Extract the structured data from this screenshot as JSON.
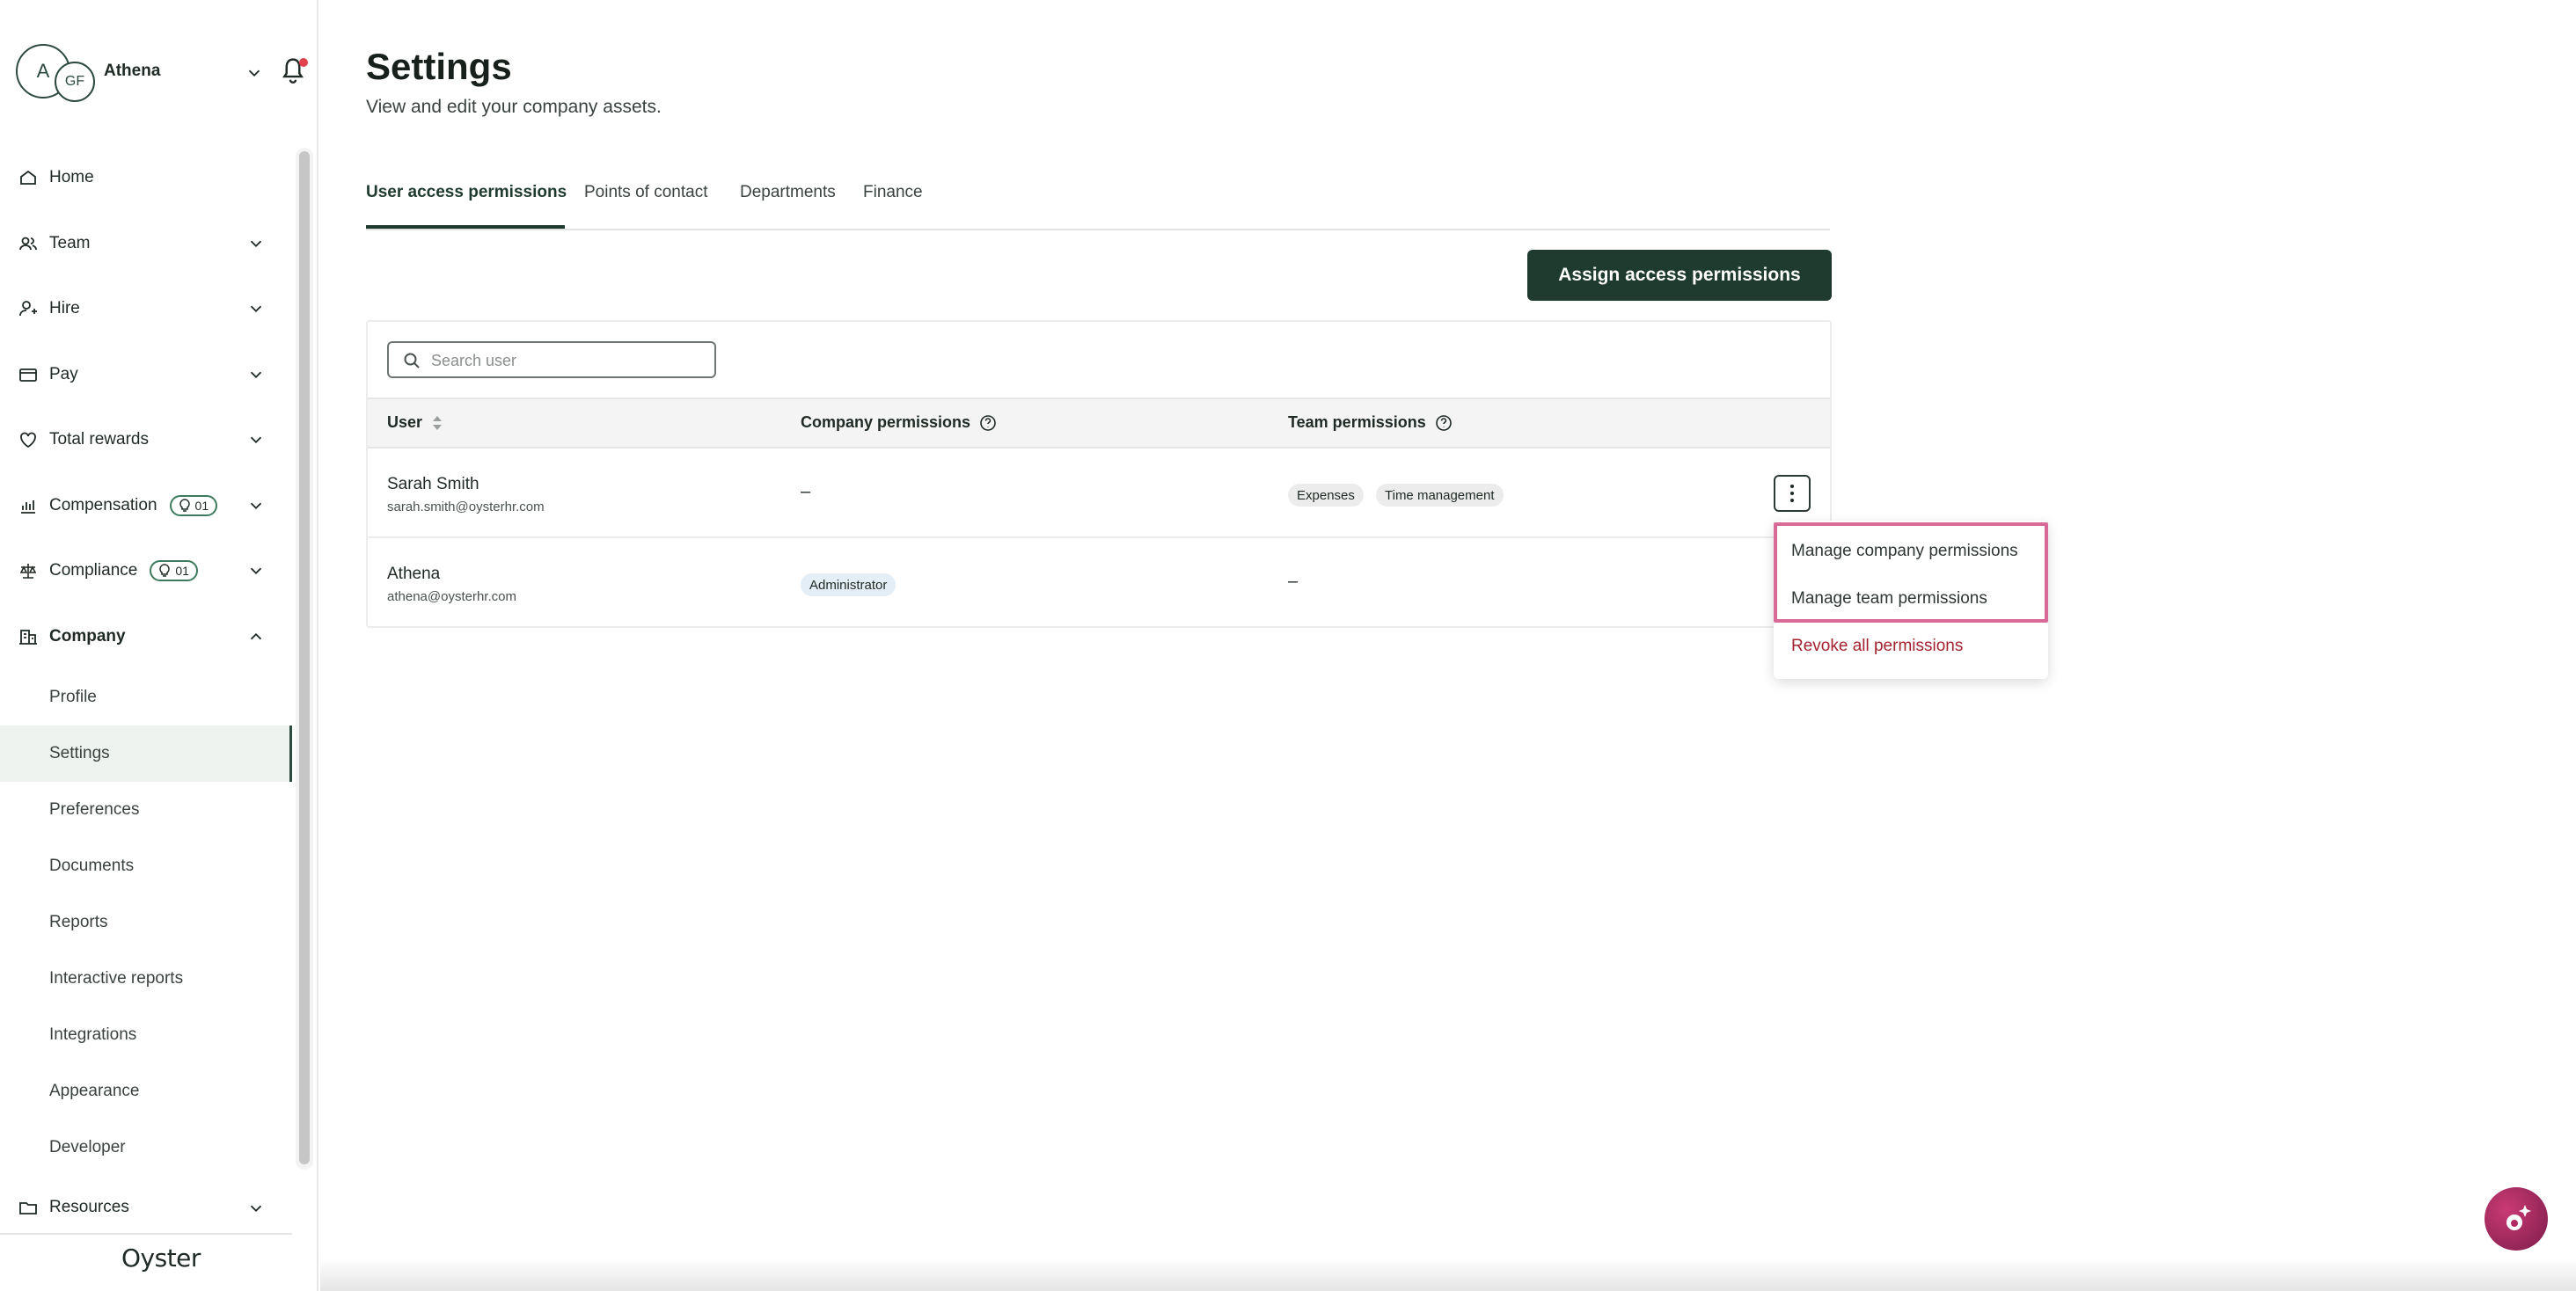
{
  "profile": {
    "avatar_initial": "A",
    "avatar_secondary": "GF",
    "name": "Athena"
  },
  "nav": {
    "items": [
      {
        "label": "Home"
      },
      {
        "label": "Team"
      },
      {
        "label": "Hire"
      },
      {
        "label": "Pay"
      },
      {
        "label": "Total rewards"
      },
      {
        "label": "Compensation",
        "badge": "01"
      },
      {
        "label": "Compliance",
        "badge": "01"
      },
      {
        "label": "Company"
      }
    ],
    "company_sub": [
      "Profile",
      "Settings",
      "Preferences",
      "Documents",
      "Reports",
      "Interactive reports",
      "Integrations",
      "Appearance",
      "Developer"
    ],
    "resources": "Resources"
  },
  "brand": "Oyster",
  "page": {
    "title": "Settings",
    "subtitle": "View and edit your company assets."
  },
  "tabs": [
    "User access permissions",
    "Points of contact",
    "Departments",
    "Finance"
  ],
  "assign_button": "Assign access permissions",
  "search": {
    "placeholder": "Search user"
  },
  "table": {
    "headers": {
      "user": "User",
      "company": "Company permissions",
      "team": "Team permissions"
    },
    "rows": [
      {
        "name": "Sarah Smith",
        "email": "sarah.smith@oysterhr.com",
        "company": "–",
        "team_tags": [
          "Expenses",
          "Time management"
        ]
      },
      {
        "name": "Athena",
        "email": "athena@oysterhr.com",
        "company_tag": "Administrator",
        "team": "–"
      }
    ]
  },
  "menu": {
    "items": [
      "Manage company permissions",
      "Manage team permissions",
      "Revoke all permissions"
    ],
    "highlight_color": "#d96a97",
    "danger_color": "#a3232f"
  },
  "colors": {
    "primary": "#1f3a2e",
    "active_bg": "#eef3f0",
    "notification": "#e0414a"
  }
}
